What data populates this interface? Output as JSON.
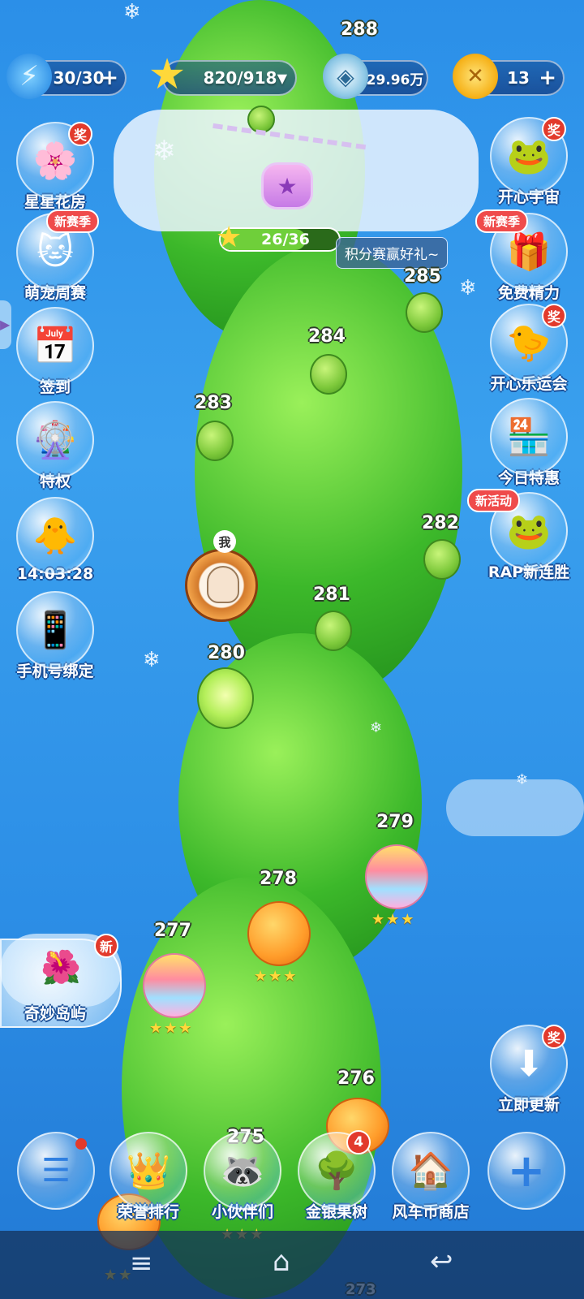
{
  "resources": {
    "energy": "30/30",
    "stars": "820/918",
    "diamonds": "29.96万",
    "coins": "13",
    "plus": "+"
  },
  "top_level": "288",
  "locked_level_stars": "26/36",
  "tooltip": "积分赛赢好礼~",
  "left_menu": [
    {
      "label": "星星花房",
      "badge": "奖"
    },
    {
      "label": "萌宠周赛",
      "badge": "新赛季"
    },
    {
      "label": "签到",
      "badge": ""
    },
    {
      "label": "特权",
      "badge": ""
    },
    {
      "label": "14:03:28",
      "badge": ""
    },
    {
      "label": "手机号绑定",
      "badge": ""
    }
  ],
  "right_menu": [
    {
      "label": "开心宇宙",
      "badge": "奖"
    },
    {
      "label": "免费精力",
      "badge": "新赛季"
    },
    {
      "label": "开心乐运会",
      "badge": "奖"
    },
    {
      "label": "今日特惠",
      "badge": ""
    },
    {
      "label": "RAP新连胜",
      "badge": "新活动"
    },
    {
      "label": "立即更新",
      "badge": "奖"
    }
  ],
  "island": {
    "label": "奇妙岛屿",
    "badge": "新"
  },
  "player_tag": "我",
  "levels": [
    "285",
    "284",
    "283",
    "282",
    "281",
    "280",
    "279",
    "278",
    "277",
    "276",
    "275",
    "273"
  ],
  "bottom_menu": [
    {
      "label": ""
    },
    {
      "label": "荣誉排行"
    },
    {
      "label": "小伙伴们"
    },
    {
      "label": "金银果树",
      "badge": "4"
    },
    {
      "label": "风车币商店"
    },
    {
      "label": ""
    }
  ],
  "icons": {
    "energy": "lightning-icon",
    "star": "star-icon",
    "diamond": "diamond-icon",
    "coin": "coin-icon"
  }
}
